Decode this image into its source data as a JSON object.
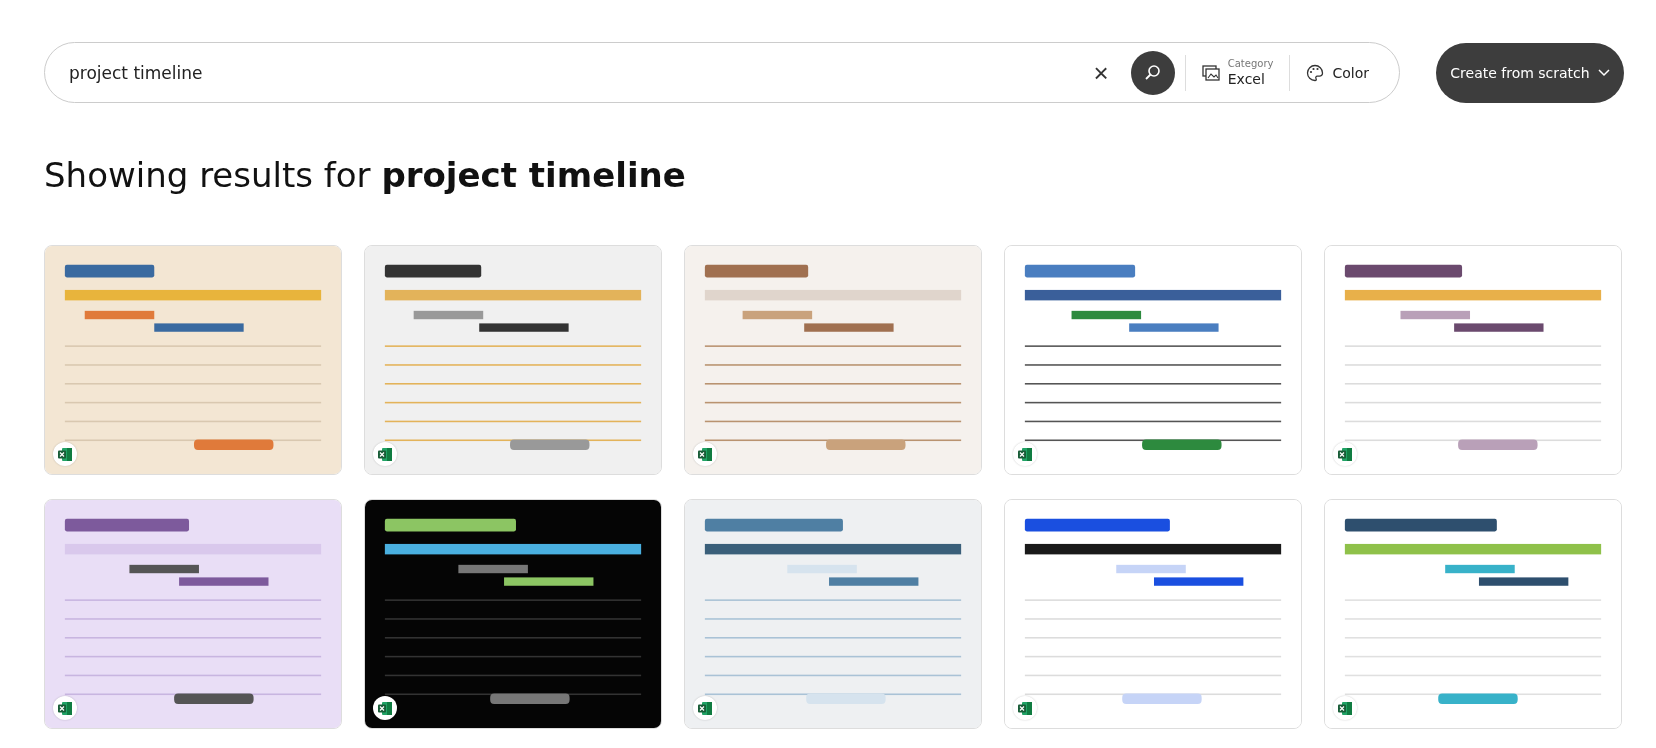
{
  "search": {
    "value": "project timeline",
    "clear_icon": "×"
  },
  "filters": [
    {
      "kind": "category",
      "caption": "Category",
      "label": "Excel"
    },
    {
      "kind": "color",
      "label": "Color"
    }
  ],
  "create_button": {
    "label": "Create from scratch"
  },
  "heading": {
    "prefix": "Showing results for ",
    "query": "project timeline"
  }
}
